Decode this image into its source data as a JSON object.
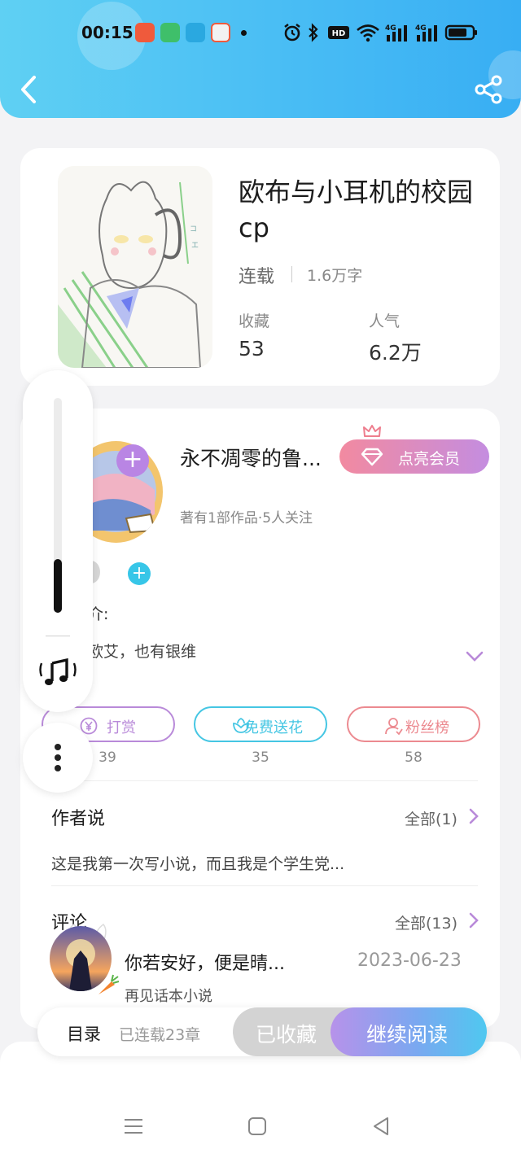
{
  "status_bar": {
    "time": "00:15",
    "network": "4G"
  },
  "header": {
    "back_icon": "chevron-left-icon",
    "share_icon": "share-icon"
  },
  "book": {
    "title": "欧布与小耳机的校园cp",
    "status": "连载",
    "word_count": "1.6万字",
    "stats": [
      {
        "label": "收藏",
        "value": "53"
      },
      {
        "label": "人气",
        "value": "6.2万"
      }
    ]
  },
  "author": {
    "name": "永不凋零的鲁...",
    "vip_button": "点亮会员",
    "meta": "著有1部作品·5人关注",
    "intro_label": "简介:",
    "intro_text": "是欧艾，也有银维"
  },
  "actions": [
    {
      "label": "打赏",
      "count": "39",
      "color": "#b98ad9",
      "icon": "yen-coin-icon"
    },
    {
      "label": "免费送花",
      "count": "35",
      "color": "#45c6e3",
      "icon": "flower-icon"
    },
    {
      "label": "粉丝榜",
      "count": "58",
      "color": "#ec8a90",
      "icon": "fan-user-icon"
    }
  ],
  "author_says": {
    "title": "作者说",
    "link": "全部(1)",
    "text": "这是我第一次写小说，而且我是个学生党..."
  },
  "comments": {
    "title": "评论",
    "link": "全部(13)",
    "items": [
      {
        "user": "你若安好，便是晴...",
        "date": "2023-06-23",
        "source": "再见话本小说"
      }
    ]
  },
  "bottom_bar": {
    "toc_label": "目录",
    "toc_count": "已连载23章",
    "favorited": "已收藏",
    "continue": "继续阅读"
  },
  "float_panel": {
    "volume_level": 0.25
  },
  "colors": {
    "header_gradient_start": "#5fd0f3",
    "header_gradient_end": "#38aef3",
    "vip_start": "#f28aa0",
    "vip_end": "#c48de0",
    "read_start": "#b792ea",
    "read_end": "#4fc8f0"
  }
}
